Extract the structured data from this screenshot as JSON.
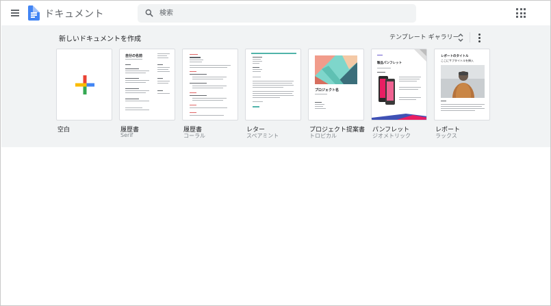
{
  "header": {
    "app_title": "ドキュメント",
    "search": {
      "placeholder": "検索",
      "value": ""
    }
  },
  "gallery": {
    "title": "新しいドキュメントを作成",
    "switch_label": "テンプレート ギャラリー",
    "templates": [
      {
        "name": "空白",
        "subtitle": ""
      },
      {
        "name": "履歴書",
        "subtitle": "Serif",
        "thumb_title": "自分の名前"
      },
      {
        "name": "履歴書",
        "subtitle": "コーラル"
      },
      {
        "name": "レター",
        "subtitle": "スペアミント"
      },
      {
        "name": "プロジェクト提案書",
        "subtitle": "トロピカル",
        "thumb_title": "プロジェクト名"
      },
      {
        "name": "パンフレット",
        "subtitle": "ジオメトリック",
        "thumb_title": "製品パンフレット"
      },
      {
        "name": "レポート",
        "subtitle": "ラックス",
        "thumb_title": "レポートのタイトル",
        "thumb_subtitle": "ここにサブタイトルを挿入"
      }
    ]
  },
  "colors": {
    "brand_blue": "#4285f4",
    "gallery_bg": "#f1f3f4",
    "plus_red": "#ea4335",
    "plus_blue": "#4285f4",
    "plus_green": "#34a853",
    "plus_yellow": "#fbbc04"
  },
  "icons": {
    "menu": "hamburger-menu-icon",
    "logo": "google-docs-icon",
    "search": "search-icon",
    "apps": "apps-grid-icon",
    "sort": "unfold-icon",
    "more": "more-vert-icon",
    "blank": "colorful-plus-icon"
  }
}
